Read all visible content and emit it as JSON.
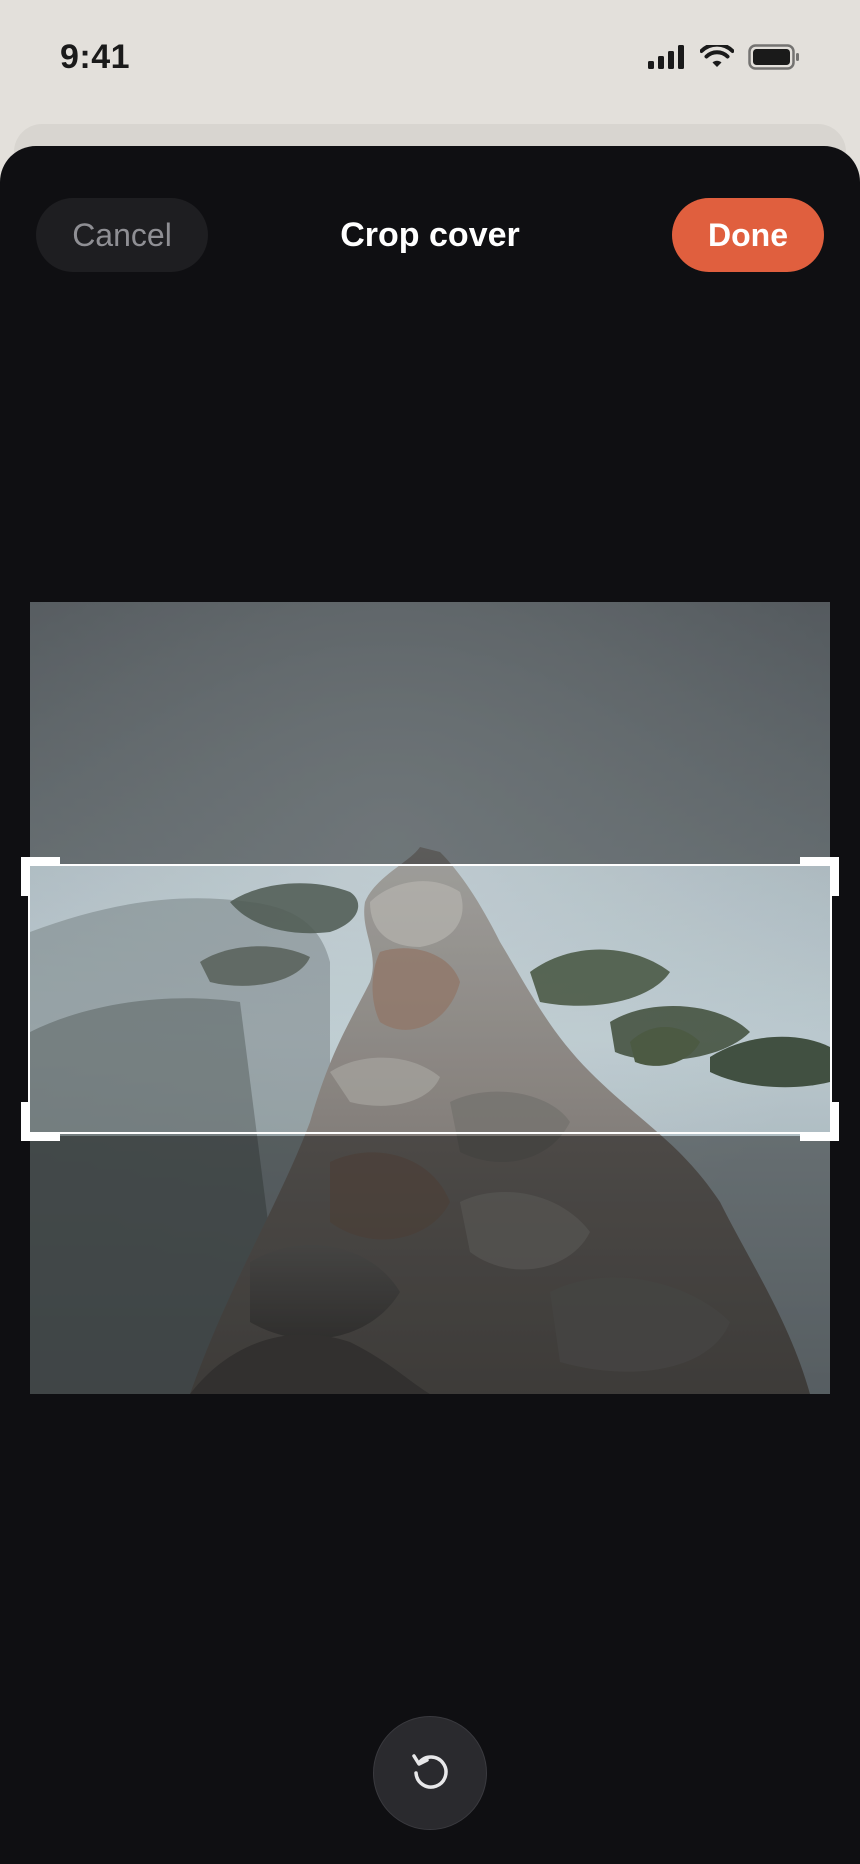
{
  "status_bar": {
    "time": "9:41",
    "icons": [
      "cellular-signal-icon",
      "wifi-icon",
      "battery-icon"
    ]
  },
  "header": {
    "cancel_label": "Cancel",
    "title": "Crop cover",
    "done_label": "Done"
  },
  "crop": {
    "image": "misty-rock-ridge-photo",
    "aspect": "wide-banner"
  },
  "toolbar": {
    "reset_icon": "rotate-reset-icon"
  },
  "colors": {
    "accent": "#e05f3e",
    "sheet_background": "#0f0f12",
    "status_background": "#e3e0db"
  }
}
